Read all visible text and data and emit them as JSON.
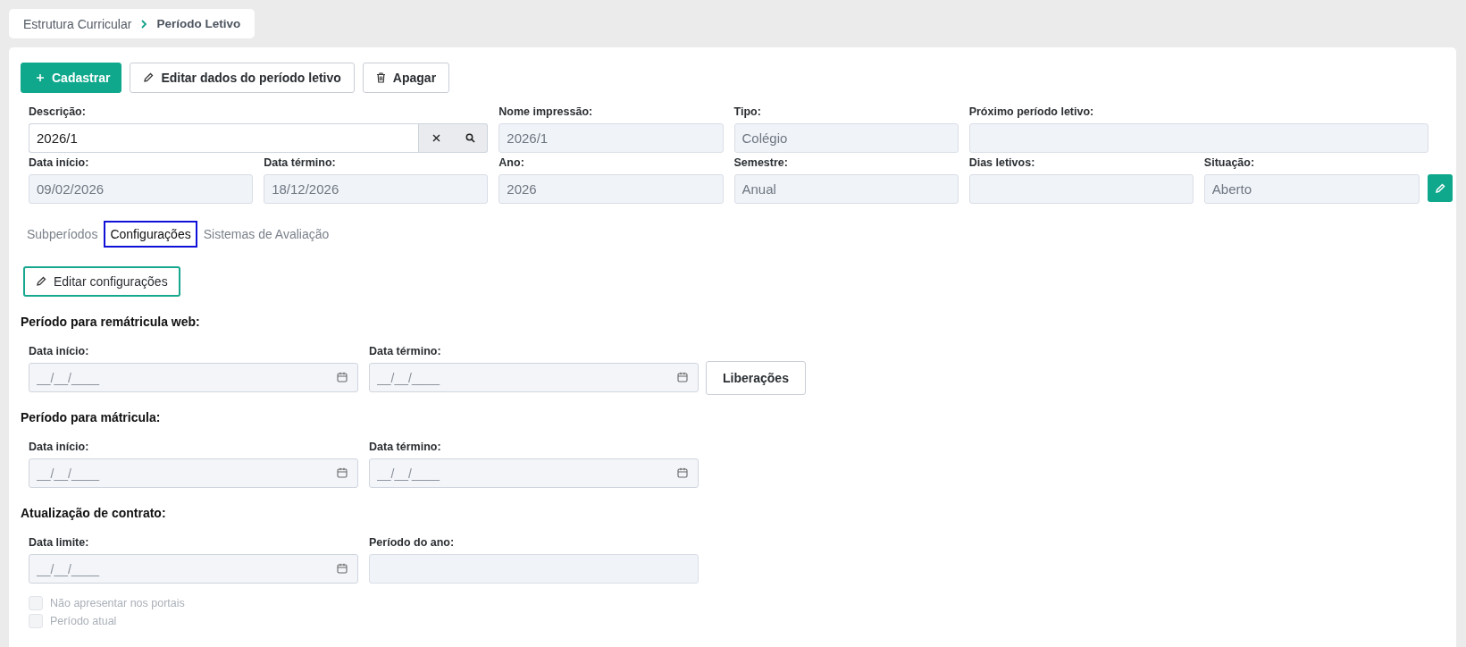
{
  "breadcrumb": [
    {
      "label": "Estrutura Curricular",
      "current": false
    },
    {
      "label": "Período Letivo",
      "current": true
    }
  ],
  "toolbar": [
    {
      "label": "Cadastrar",
      "kind": "primary"
    },
    {
      "label": "Editar dados do período letivo",
      "kind": "edit"
    },
    {
      "label": "Apagar",
      "kind": "delete"
    }
  ],
  "main_fields": [
    {
      "label": "Descrição:",
      "value": "2026/1",
      "kind": "search",
      "disabled": false
    },
    {
      "label": "Nome impressão:",
      "value": "2026/1",
      "kind": "text",
      "disabled": true
    },
    {
      "label": "Tipo:",
      "value": "Colégio",
      "kind": "text",
      "disabled": true
    },
    {
      "label": "Próximo período letivo:",
      "kind": "wide",
      "disabled": true
    },
    {
      "label": "Data início:",
      "value": "09/02/2026",
      "kind": "text",
      "disabled": true
    },
    {
      "label": "Data término:",
      "value": "18/12/2026",
      "kind": "text",
      "disabled": true
    },
    {
      "label": "Ano:",
      "value": "2026",
      "kind": "text",
      "disabled": true
    },
    {
      "label": "Semestre:",
      "value": "Anual",
      "kind": "text",
      "disabled": true
    },
    {
      "label": "Dias letivos:",
      "kind": "text",
      "disabled": true
    },
    {
      "label": "Situação:",
      "value": "Aberto",
      "kind": "editable",
      "disabled": true
    }
  ],
  "tabs": [
    {
      "label": "Subperíodos",
      "selected": false
    },
    {
      "label": "Configurações",
      "selected": true
    },
    {
      "label": "Sistemas de Avaliação",
      "selected": false
    }
  ],
  "edit_button": "Editar configurações",
  "sections": [
    {
      "title": "Período para remátricula web:",
      "fields": [
        {
          "label": "Data início:",
          "placeholder": "__/__/____",
          "kind": "date"
        },
        {
          "label": "Data término:",
          "placeholder": "__/__/____",
          "kind": "date"
        }
      ],
      "button": "Liberações"
    },
    {
      "title": "Período para mátricula:",
      "fields": [
        {
          "label": "Data início:",
          "placeholder": "__/__/____",
          "kind": "date"
        },
        {
          "label": "Data término:",
          "placeholder": "__/__/____",
          "kind": "date"
        }
      ]
    },
    {
      "title": "Atualização de contrato:",
      "fields": [
        {
          "label": "Data limite:",
          "placeholder": "__/__/____",
          "kind": "date"
        },
        {
          "label": "Período do ano:",
          "kind": "text"
        }
      ]
    }
  ],
  "checkboxes": [
    {
      "label": "Não apresentar nos portais",
      "checked": false,
      "disabled": true
    },
    {
      "label": "Período atual",
      "checked": false,
      "disabled": true
    }
  ]
}
